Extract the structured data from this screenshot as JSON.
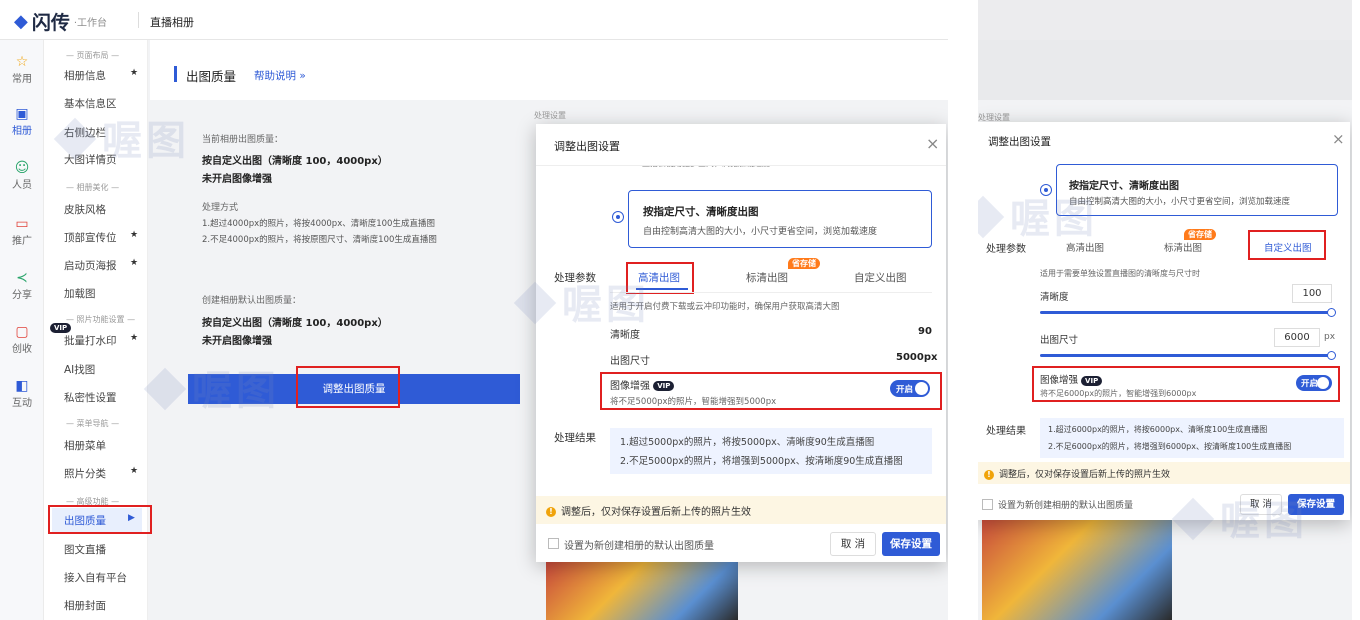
{
  "left": {
    "logo": {
      "brand": "闪传",
      "sub": "·工作台"
    },
    "topbar_title": "直播相册",
    "iconbar": [
      "常用",
      "相册",
      "人员",
      "推广",
      "分享",
      "创收",
      "互动"
    ],
    "subnav": {
      "group1": "— 页面布局 —",
      "items1": [
        "相册信息",
        "基本信息区",
        "右侧边栏",
        "大图详情页"
      ],
      "group2": "— 相册美化 —",
      "items2": [
        "皮肤风格",
        "顶部宣传位",
        "启动页海报",
        "加载图"
      ],
      "group3": "— 照片功能设置 —",
      "items3": [
        "批量打水印",
        "AI找图",
        "私密性设置"
      ],
      "group4": "— 菜单导航 —",
      "items4": [
        "相册菜单",
        "照片分类"
      ],
      "group5": "— 高级功能 —",
      "items5": [
        "出图质量",
        "图文直播",
        "接入自有平台",
        "相册封面"
      ],
      "star": "★",
      "vip": "VIP"
    },
    "page_title": "出图质量",
    "help_link": "帮助说明 »",
    "card1": {
      "label": "当前相册出图质量：",
      "line1": "按自定义出图（清晰度 100，4000px）",
      "line2": "未开启图像增强",
      "method_label": "处理方式",
      "m1": "1.超过4000px的照片，将按4000px、清晰度100生成直播图",
      "m2": "2.不足4000px的照片，将按原图尺寸、清晰度100生成直播图"
    },
    "card2": {
      "label": "创建相册默认出图质量：",
      "line1": "按自定义出图（清晰度 100，4000px）",
      "line2": "未开启图像增强"
    },
    "adjust_button": "调整出图质量",
    "modal": {
      "title": "调整出图设置",
      "close": "×",
      "clipped_text": "直播云使用更多空间，浏览加载速度",
      "option_title": "按指定尺寸、清晰度出图",
      "option_desc": "自由控制高清大图的大小，小尺寸更省空间，浏览加载速度",
      "params_label": "处理参数",
      "tabs": [
        "高清出图",
        "标清出图",
        "自定义出图"
      ],
      "badge": "省存储",
      "hint": "适用于开启付费下载或云冲印功能时，确保用户获取高清大图",
      "clarity_label": "清晰度",
      "clarity_value": "90",
      "size_label": "出图尺寸",
      "size_value": "5000px",
      "enhance_label": "图像增强",
      "enhance_desc": "将不足5000px的照片，智能增强到5000px",
      "toggle_label": "开启",
      "result_label": "处理结果",
      "r1": "1.超过5000px的照片，将按5000px、清晰度90生成直播图",
      "r2": "2.不足5000px的照片，将增强到5000px、按清晰度90生成直播图",
      "notice": "调整后，仅对保存设置后新上传的照片生效",
      "default_check": "设置为新创建相册的默认出图质量",
      "cancel": "取 消",
      "save": "保存设置"
    },
    "peek_text": "处理设置"
  },
  "right": {
    "modal": {
      "title": "调整出图设置",
      "close": "×",
      "option_title": "按指定尺寸、清晰度出图",
      "option_desc": "自由控制高清大图的大小，小尺寸更省空间，浏览加载速度",
      "params_label": "处理参数",
      "tabs": [
        "高清出图",
        "标清出图",
        "自定义出图"
      ],
      "badge": "省存储",
      "hint": "适用于需要单独设置直播图的清晰度与尺寸时",
      "clarity_label": "清晰度",
      "clarity_value": "100",
      "size_label": "出图尺寸",
      "size_value": "6000",
      "size_unit": "px",
      "enhance_label": "图像增强",
      "enhance_desc": "将不足6000px的照片，智能增强到6000px",
      "toggle_label": "开启",
      "result_label": "处理结果",
      "r1": "1.超过6000px的照片，将按6000px、清晰度100生成直播图",
      "r2": "2.不足6000px的照片，将增强到6000px、按清晰度100生成直播图",
      "notice": "调整后，仅对保存设置后新上传的照片生效",
      "default_check": "设置为新创建相册的默认出图质量",
      "cancel": "取 消",
      "save": "保存设置"
    },
    "peek_text": "处理设置"
  },
  "watermark": "喔图",
  "colors": {
    "accent": "#2f5bd6",
    "highlight": "#e02020",
    "badge": "#ff7a1a"
  }
}
